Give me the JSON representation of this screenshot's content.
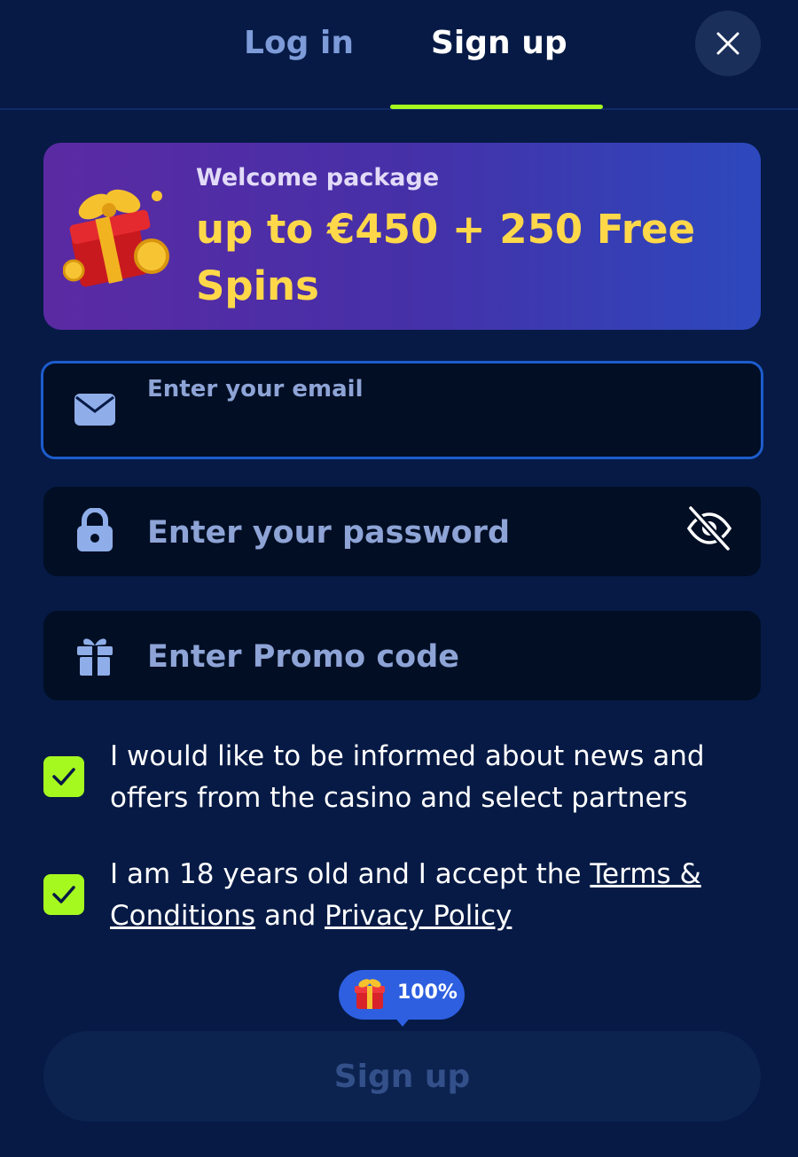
{
  "tabs": {
    "login_label": "Log in",
    "signup_label": "Sign up",
    "active": "signup"
  },
  "close_icon": "close-icon",
  "promo": {
    "subtitle": "Welcome package",
    "title": "up to €450 + 250 Free Spins",
    "icon": "gift-icon"
  },
  "form": {
    "email": {
      "label": "Enter your email",
      "value": "",
      "icon": "mail-icon"
    },
    "password": {
      "placeholder": "Enter your password",
      "value": "",
      "icon": "lock-icon",
      "toggle_icon": "eye-off-icon"
    },
    "promo_code": {
      "placeholder": "Enter Promo code",
      "value": "",
      "icon": "gift-icon"
    }
  },
  "consents": {
    "news": {
      "checked": true,
      "text": "I would like to be informed about news and offers from the casino and select partners"
    },
    "terms": {
      "checked": true,
      "text_before": "I am 18 years old and I accept the ",
      "terms_link": "Terms & Conditions",
      "text_middle": " and ",
      "privacy_link": "Privacy Policy"
    }
  },
  "bonus_badge": {
    "text": "100%",
    "icon": "gift-icon"
  },
  "submit": {
    "label": "Sign up"
  },
  "colors": {
    "background": "#061a45",
    "accent": "#a6f91f",
    "promo_text": "#ffd84a",
    "field_bg": "#010e24",
    "focus_border": "#1d5ccc"
  }
}
